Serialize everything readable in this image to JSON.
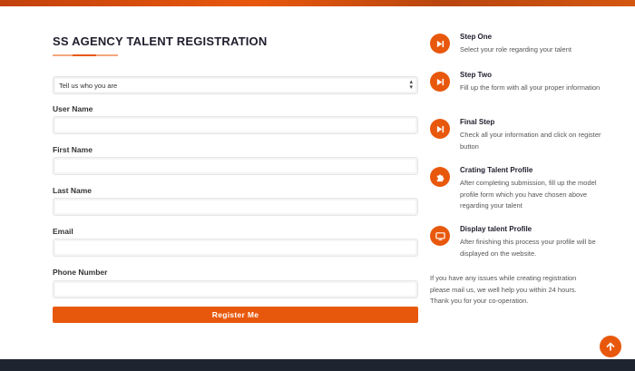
{
  "page": {
    "title": "SS AGENCY TALENT REGISTRATION",
    "accent_color": "#e8580c",
    "footer_color": "#1e2430"
  },
  "form": {
    "role_select": {
      "selected": "Tell us who you are",
      "icon": "select-updown-arrows"
    },
    "fields": [
      {
        "label": "User Name",
        "value": ""
      },
      {
        "label": "First Name",
        "value": ""
      },
      {
        "label": "Last Name",
        "value": ""
      },
      {
        "label": "Email",
        "value": ""
      },
      {
        "label": "Phone Number",
        "value": ""
      }
    ],
    "submit_label": "Register Me"
  },
  "steps": [
    {
      "title": "Step One",
      "desc": "Select your role regarding your talent",
      "icon": "skip-icon"
    },
    {
      "title": "Step Two",
      "desc": "Fill up the form with all your proper information",
      "icon": "skip-icon"
    },
    {
      "title": "Final Step",
      "desc": "Check all your information and click on register button",
      "icon": "skip-icon"
    },
    {
      "title": "Crating Talent Profile",
      "desc": "After completing submission, fill up the model profile form which you have chosen above regarding your talent",
      "icon": "puzzle-icon"
    },
    {
      "title": "Display talent Profile",
      "desc": "After finishing this process your profile will be displayed on the website.",
      "icon": "monitor-icon"
    }
  ],
  "help_text": "If you have any issues while creating registration please mail us, we well help you within 24 hours. Thank you for your co-operation.",
  "scroll_top": {
    "icon": "arrow-up-icon"
  }
}
